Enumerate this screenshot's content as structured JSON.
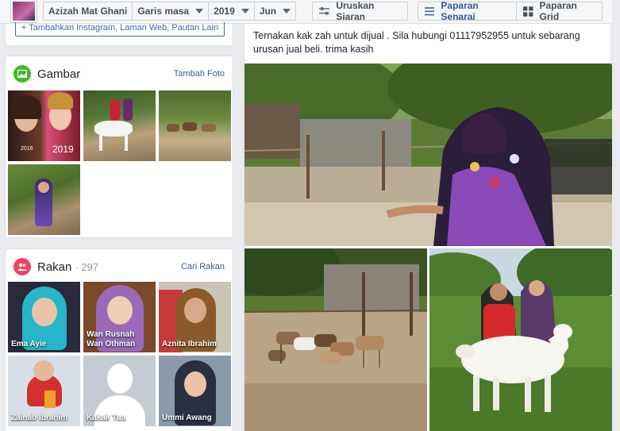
{
  "header": {
    "profile_name": "Azizah Mat Ghani",
    "timeline_label": "Garis masa",
    "year": "2019",
    "month": "Jun",
    "manage_posts": "Uruskan Siaran",
    "list_view": "Paparan Senarai",
    "grid_view": "Paparan Grid"
  },
  "intro": {
    "add_links_label": "Tambahkan Instagram, Laman Web, Pautan Lain"
  },
  "photos": {
    "title": "Gambar",
    "add_link": "Tambah Foto",
    "thumb_year": "2019",
    "thumb_small_year": "2016"
  },
  "friends": {
    "title": "Rakan",
    "count": "· 297",
    "find_link": "Cari Rakan",
    "items": [
      {
        "name": "Ema Ayie"
      },
      {
        "name": "Wan Rusnah\nWan Othman"
      },
      {
        "name": "Aznita Ibrahim"
      },
      {
        "name": "Zainab Ibrahim"
      },
      {
        "name": "Kakak Tua"
      },
      {
        "name": "Ummi Awang"
      }
    ]
  },
  "post": {
    "text": "Ternakan kak zah untuk dijual . Sila hubungi 01117952955 untuk sebarang urusan jual beli. trima kasih"
  },
  "colors": {
    "accent": "#365899",
    "photos_icon": "#42b72a",
    "friends_icon": "#f3425f"
  }
}
